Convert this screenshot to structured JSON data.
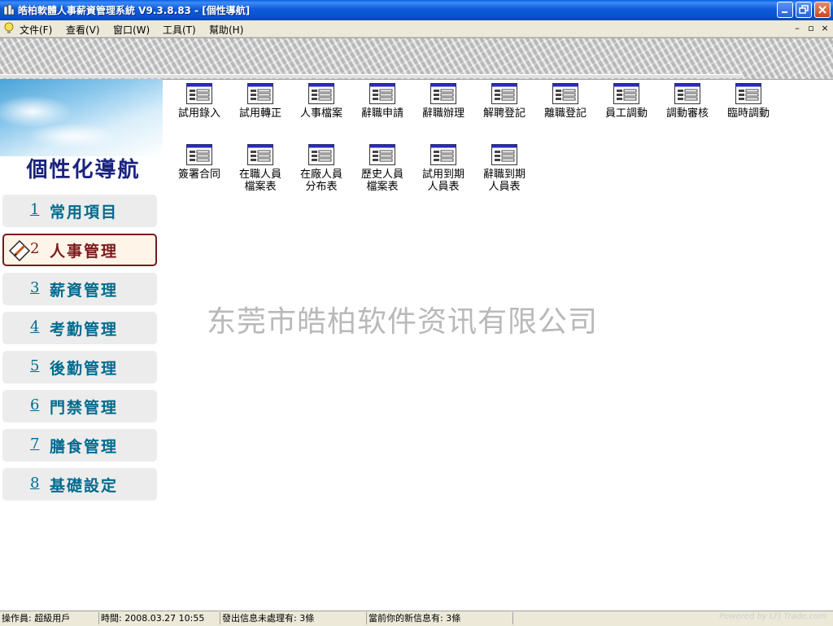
{
  "window": {
    "title": "皓柏軟體人事薪資管理系統 V9.3.8.83 - [個性導航]",
    "icons": {
      "app": "app-icon",
      "minimize": "minimize-icon",
      "restore": "restore-icon",
      "close": "close-icon"
    }
  },
  "menu": {
    "items": [
      "文件(F)",
      "查看(V)",
      "窗口(W)",
      "工具(T)",
      "幫助(H)"
    ],
    "mdi_controls": [
      "–",
      "▫",
      "×"
    ]
  },
  "nav": {
    "title": "個性化導航",
    "items": [
      {
        "num": "1",
        "label": "常用項目"
      },
      {
        "num": "2",
        "label": "人事管理",
        "active": true
      },
      {
        "num": "3",
        "label": "薪資管理"
      },
      {
        "num": "4",
        "label": "考勤管理"
      },
      {
        "num": "5",
        "label": "後勤管理"
      },
      {
        "num": "6",
        "label": "門禁管理"
      },
      {
        "num": "7",
        "label": "膳食管理"
      },
      {
        "num": "8",
        "label": "基礎設定"
      }
    ]
  },
  "modules": [
    "試用錄入",
    "試用轉正",
    "人事檔案",
    "辭職申請",
    "辭職辦理",
    "解聘登記",
    "離職登記",
    "員工調動",
    "調動審核",
    "臨時調動",
    "簽署合同",
    "在職人員\n檔案表",
    "在廠人員\n分布表",
    "歷史人員\n檔案表",
    "試用到期\n人員表",
    "辭職到期\n人員表"
  ],
  "watermark": "东莞市皓柏软件资讯有限公司",
  "status": {
    "operator": "操作員: 超級用戶",
    "time": "時間: 2008.03.27 10:55",
    "sent": "發出信息未處理有: 3條",
    "new": "當前你的新信息有: 3條",
    "credit": "Powered by LFJ Trade.com"
  },
  "colors": {
    "titlebar": "#0a5fe4",
    "nav_text": "#006b8f",
    "nav_active": "#7a1a1a",
    "nav_title": "#1a237e"
  }
}
